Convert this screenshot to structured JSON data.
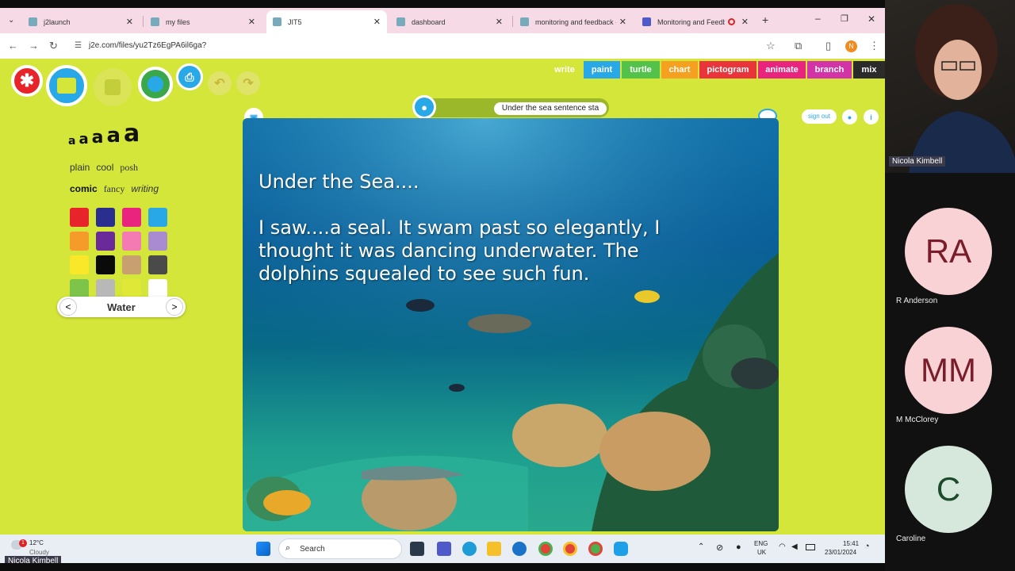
{
  "browser": {
    "tabs": [
      {
        "title": "j2launch"
      },
      {
        "title": "my files"
      },
      {
        "title": "JIT5"
      },
      {
        "title": "dashboard"
      },
      {
        "title": "monitoring and feedback -"
      },
      {
        "title": "Monitoring and Feedb"
      }
    ],
    "url": "j2e.com/files/yu2Tz6EgPA6il6ga?",
    "profile_initial": "N"
  },
  "app": {
    "menu": [
      {
        "label": "write",
        "color": "#d4e63a"
      },
      {
        "label": "paint",
        "color": "#29a8e8"
      },
      {
        "label": "turtle",
        "color": "#52c24a"
      },
      {
        "label": "chart",
        "color": "#f5a01e"
      },
      {
        "label": "pictogram",
        "color": "#e8343a"
      },
      {
        "label": "animate",
        "color": "#e8247e"
      },
      {
        "label": "branch",
        "color": "#d234a8"
      },
      {
        "label": "mix",
        "color": "#2b2b2b"
      }
    ],
    "sizes": [
      "a",
      "a",
      "a",
      "a",
      "a"
    ],
    "fonts_row1": [
      "plain",
      "cool",
      "posh"
    ],
    "fonts_row2": [
      "comic",
      "fancy",
      "writing"
    ],
    "colors": [
      "#e8242b",
      "#2a2f8f",
      "#e8247e",
      "#29a8e8",
      "#f59b2a",
      "#6a2a9a",
      "#f47ab3",
      "#a88bd0",
      "#f9e82a",
      "#0a0a0a",
      "#c8a070",
      "#4a4a4a",
      "#7cc44a",
      "#b8b8b8",
      "#d4e63a",
      "#ffffff"
    ],
    "background_name": "Water",
    "title_field": "Under the sea sentence sta",
    "sign_out": "sign out",
    "canvas_text": {
      "line1": "Under the Sea....",
      "line2": "I saw....a seal. It swam past so elegantly, I",
      "line3": "thought it was dancing underwater. The",
      "line4": "dolphins squealed to see such fun."
    }
  },
  "taskbar": {
    "weather_temp": "12°C",
    "weather_desc": "Cloudy",
    "search": "Search",
    "lang1": "ENG",
    "lang2": "UK",
    "time": "15:41",
    "date": "23/01/2024",
    "presenter": "Nicola Kimbell"
  },
  "participants": [
    {
      "name": "Nicola Kimbell"
    },
    {
      "initials": "RA",
      "name": "R Anderson",
      "color": "#f8d2d5"
    },
    {
      "initials": "MM",
      "name": "M McClorey",
      "color": "#f8d2d5"
    },
    {
      "initials": "C",
      "name": "Caroline",
      "color": "#d6e8dc"
    }
  ]
}
